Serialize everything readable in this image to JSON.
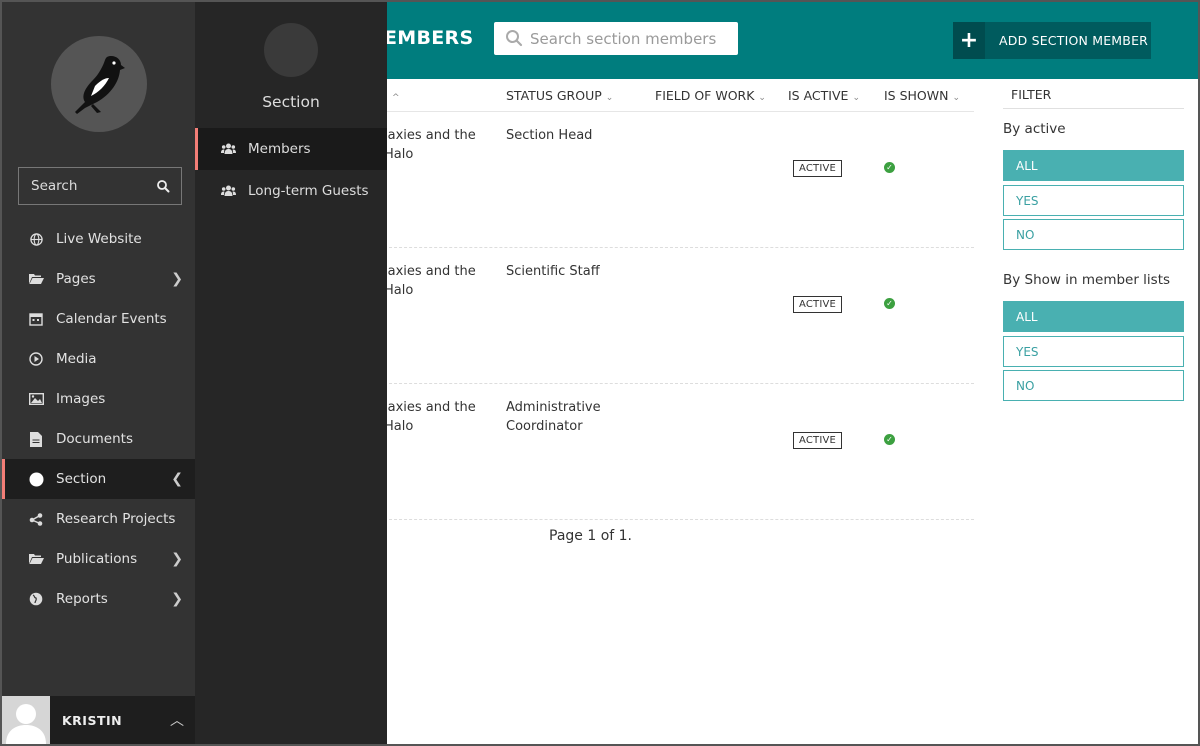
{
  "header": {
    "page_title_visible": "EMBERS",
    "search_placeholder": "Search section members",
    "add_button_label": "ADD SECTION MEMBER",
    "accent_color": "#007d7e"
  },
  "table": {
    "columns": {
      "title_caret": "^",
      "status_group": "STATUS GROUP",
      "field_of_work": "FIELD OF WORK",
      "is_active": "IS ACTIVE",
      "is_shown": "IS SHOWN"
    },
    "rows": [
      {
        "title_line1": "laxies and the",
        "title_line2": "Halo",
        "status_group": "Section Head",
        "field_of_work": "",
        "active_badge": "ACTIVE",
        "shown": true
      },
      {
        "title_line1": "laxies and the",
        "title_line2": "Halo",
        "status_group": "Scientific Staff",
        "field_of_work": "",
        "active_badge": "ACTIVE",
        "shown": true
      },
      {
        "title_line1": "laxies and the",
        "title_line2": "Halo",
        "status_group": "Administrative",
        "status_group_line2": "Coordinator",
        "field_of_work": "",
        "active_badge": "ACTIVE",
        "shown": true
      }
    ],
    "pagination": "Page 1 of 1."
  },
  "filter": {
    "heading": "FILTER",
    "by_active_label": "By active",
    "by_active_options": [
      "ALL",
      "YES",
      "NO"
    ],
    "by_active_selected": "ALL",
    "by_show_label": "By Show in member lists",
    "by_show_options": [
      "ALL",
      "YES",
      "NO"
    ],
    "by_show_selected": "ALL"
  },
  "sidebar": {
    "search_placeholder": "Search",
    "items": [
      {
        "label": "Live Website",
        "icon": "globe-icon"
      },
      {
        "label": "Pages",
        "icon": "folder-open-icon",
        "has_children": true
      },
      {
        "label": "Calendar Events",
        "icon": "calendar-icon"
      },
      {
        "label": "Media",
        "icon": "play-icon"
      },
      {
        "label": "Images",
        "icon": "image-icon"
      },
      {
        "label": "Documents",
        "icon": "document-icon"
      },
      {
        "label": "Section",
        "icon": "circle-icon",
        "active": true,
        "expanded": true
      },
      {
        "label": "Research Projects",
        "icon": "share-icon"
      },
      {
        "label": "Publications",
        "icon": "folder-open-icon",
        "has_children": true
      },
      {
        "label": "Reports",
        "icon": "globe-icon",
        "has_children": true
      }
    ],
    "user_name": "KRISTIN"
  },
  "submenu": {
    "title": "Section",
    "items": [
      {
        "label": "Members",
        "icon": "group-icon",
        "active": true
      },
      {
        "label": "Long-term Guests",
        "icon": "group-icon"
      }
    ]
  }
}
